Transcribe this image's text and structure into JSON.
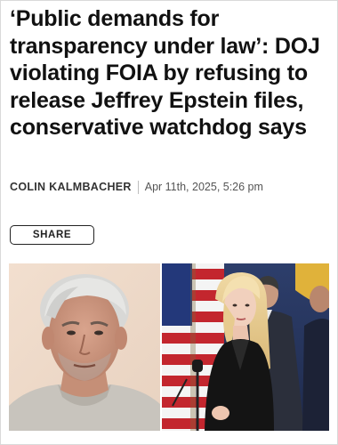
{
  "article": {
    "headline": "‘Public demands for transparency under law’: DOJ violating FOIA by refusing to release Jeffrey Epstein files, conservative watchdog says",
    "author": "COLIN KALMBACHER",
    "datetime": "Apr 11th, 2025, 5:26 pm"
  },
  "actions": {
    "share_label": "SHARE"
  },
  "images": {
    "left_alt": "mugshot-photo",
    "right_alt": "press-conference-photo"
  },
  "colors": {
    "text": "#111111",
    "muted": "#555555",
    "border": "#222222"
  }
}
